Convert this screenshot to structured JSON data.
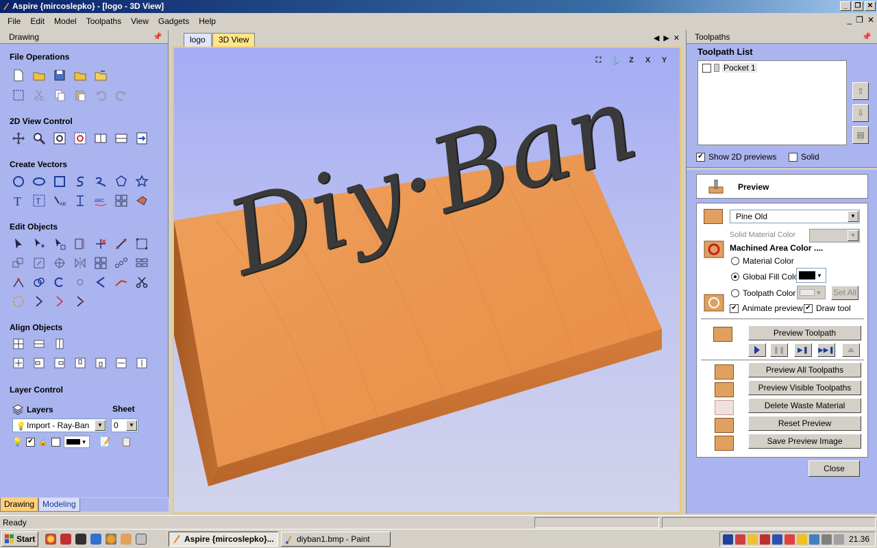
{
  "window": {
    "title": "Aspire {mircoslepko} - [logo - 3D View]"
  },
  "menu": [
    "File",
    "Edit",
    "Model",
    "Toolpaths",
    "View",
    "Gadgets",
    "Help"
  ],
  "left_panel": {
    "header": "Drawing",
    "sections": {
      "file_operations": "File Operations",
      "view_control": "2D View Control",
      "create_vectors": "Create Vectors",
      "edit_objects": "Edit Objects",
      "align_objects": "Align Objects",
      "layer_control": "Layer Control"
    },
    "layers": {
      "label": "Layers",
      "sheet_label": "Sheet",
      "current_layer": "Import - Ray-Ban",
      "sheet_value": "0"
    },
    "bottom_tabs": [
      "Drawing",
      "Modeling"
    ]
  },
  "doc_tabs": [
    "logo",
    "3D View"
  ],
  "view": {
    "carved_text": "Diy·Ban",
    "axis_icons": [
      "Z",
      "X",
      "Y"
    ]
  },
  "right_panel": {
    "header": "Toolpaths",
    "list_title": "Toolpath List",
    "items": [
      "Pocket 1"
    ],
    "show_2d_label": "Show 2D previews",
    "solid_label": "Solid",
    "preview_title": "Preview",
    "material": "Pine Old",
    "solid_material_color": "Solid Material Color",
    "machined_area_color": "Machined Area Color ....",
    "radio_material": "Material Color",
    "radio_global": "Global Fill Color",
    "radio_toolpath": "Toolpath Color",
    "set_all": "Set All",
    "animate_preview": "Animate preview",
    "draw_tool": "Draw tool",
    "buttons": {
      "preview_toolpath": "Preview Toolpath",
      "preview_all": "Preview All Toolpaths",
      "preview_visible": "Preview Visible Toolpaths",
      "delete_waste": "Delete Waste Material",
      "reset_preview": "Reset Preview",
      "save_image": "Save Preview Image",
      "close": "Close"
    }
  },
  "status": {
    "text": "Ready"
  },
  "taskbar": {
    "start": "Start",
    "items": [
      "Aspire {mircoslepko}...",
      "diyban1.bmp - Paint"
    ],
    "clock": "21.36"
  },
  "colors": {
    "wood": "#e8914c",
    "carve": "#3a3a3a",
    "panel_bg": "#aab4ee"
  }
}
